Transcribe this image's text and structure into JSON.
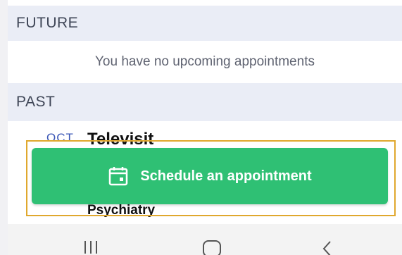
{
  "future": {
    "header": "FUTURE",
    "empty_message": "You have no upcoming appointments"
  },
  "past": {
    "header": "PAST",
    "items": [
      {
        "month": "OCT",
        "title": "Televisit",
        "subtitle": "Psychiatry"
      }
    ]
  },
  "schedule_button": {
    "label": "Schedule an appointment",
    "icon": "calendar-icon",
    "color": "#2fc074"
  },
  "highlight_color": "#e0a82e",
  "nav": {
    "recents_icon": "recents-icon",
    "home_icon": "home-icon",
    "back_icon": "back-icon"
  }
}
